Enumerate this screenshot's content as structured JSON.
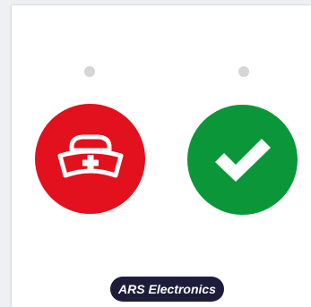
{
  "panel": {
    "buttons": [
      {
        "name": "nurse-call",
        "icon": "nurse-cap-icon",
        "color": "#e3101d"
      },
      {
        "name": "confirm",
        "icon": "checkmark-icon",
        "color": "#0b9739"
      }
    ],
    "indicator_color": "#d6d6d6"
  },
  "footer": {
    "brand_label": "ARS Electronics",
    "brand_bg": "#1d1d3b"
  }
}
